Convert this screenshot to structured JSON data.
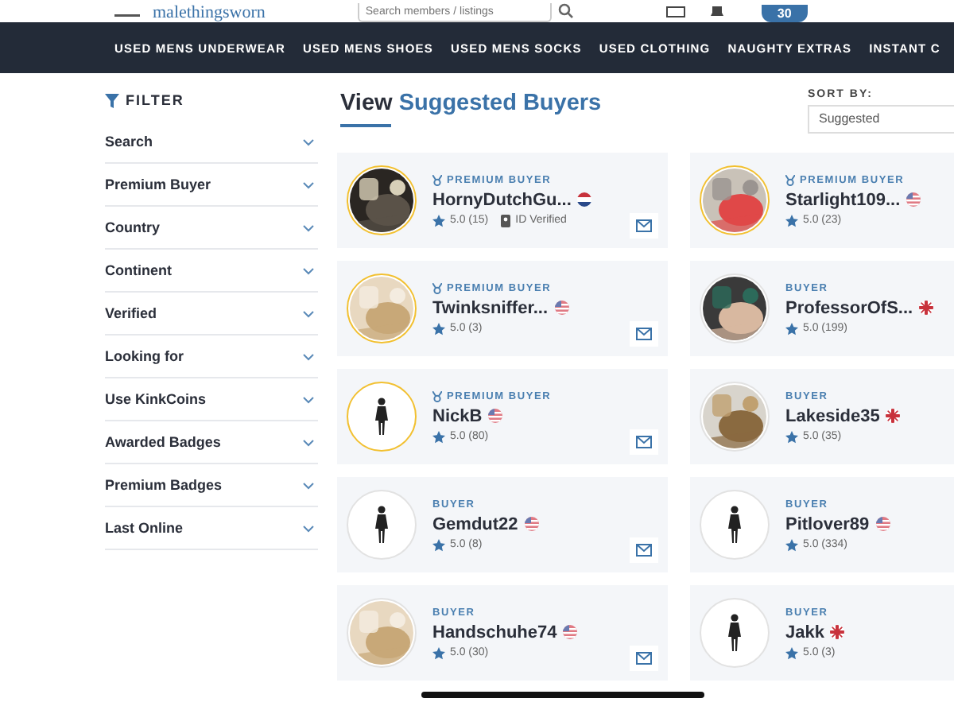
{
  "header": {
    "logo": "malethingsworn",
    "search": {
      "placeholder": "Search members / listings"
    },
    "cart_count": "30"
  },
  "nav": [
    "USED MENS UNDERWEAR",
    "USED MENS SHOES",
    "USED MENS SOCKS",
    "USED CLOTHING",
    "NAUGHTY EXTRAS",
    "INSTANT C"
  ],
  "filter": {
    "title": "FILTER",
    "items": [
      "Search",
      "Premium Buyer",
      "Country",
      "Continent",
      "Verified",
      "Looking for",
      "Use KinkCoins",
      "Awarded Badges",
      "Premium Badges",
      "Last Online"
    ]
  },
  "heading": {
    "prefix": "View",
    "accent": "Suggested Buyers"
  },
  "sort": {
    "label": "SORT BY:",
    "value": "Suggested"
  },
  "buyers": [
    {
      "premium": true,
      "tier_label": "PREMIUM BUYER",
      "name": "HornyDutchGu...",
      "flag": {
        "kind": "nl"
      },
      "rating": "5.0",
      "count": "(15)",
      "verified": "ID Verified",
      "mail": true
    },
    {
      "premium": true,
      "tier_label": "PREMIUM BUYER",
      "name": "Starlight109...",
      "flag": {
        "kind": "us"
      },
      "rating": "5.0",
      "count": "(23)",
      "mail": false
    },
    {
      "premium": true,
      "tier_label": "PREMIUM BUYER",
      "name": "Twinksniffer...",
      "flag": {
        "kind": "us"
      },
      "rating": "5.0",
      "count": "(3)",
      "mail": true
    },
    {
      "premium": false,
      "tier_label": "BUYER",
      "name": "ProfessorOfS...",
      "flag": {
        "kind": "gb"
      },
      "rating": "5.0",
      "count": "(199)",
      "mail": false
    },
    {
      "premium": true,
      "tier_label": "PREMIUM BUYER",
      "name": "NickB",
      "flag": {
        "kind": "us"
      },
      "rating": "5.0",
      "count": "(80)",
      "avatar": {
        "kind": "figure"
      },
      "mail": true
    },
    {
      "premium": false,
      "tier_label": "BUYER",
      "name": "Lakeside35",
      "flag": {
        "kind": "gb"
      },
      "rating": "5.0",
      "count": "(35)",
      "mail": false
    },
    {
      "premium": false,
      "tier_label": "BUYER",
      "name": "Gemdut22",
      "flag": {
        "kind": "us"
      },
      "rating": "5.0",
      "count": "(8)",
      "avatar": {
        "kind": "figure"
      },
      "mail": true
    },
    {
      "premium": false,
      "tier_label": "BUYER",
      "name": "Pitlover89",
      "flag": {
        "kind": "us"
      },
      "rating": "5.0",
      "count": "(334)",
      "avatar": {
        "kind": "figure"
      },
      "mail": false
    },
    {
      "premium": false,
      "tier_label": "BUYER",
      "name": "Handschuhe74",
      "flag": {
        "kind": "us"
      },
      "rating": "5.0",
      "count": "(30)",
      "mail": true
    },
    {
      "premium": false,
      "tier_label": "BUYER",
      "name": "Jakk",
      "flag": {
        "kind": "gb"
      },
      "rating": "5.0",
      "count": "(3)",
      "avatar": {
        "kind": "figure"
      },
      "mail": false
    }
  ]
}
